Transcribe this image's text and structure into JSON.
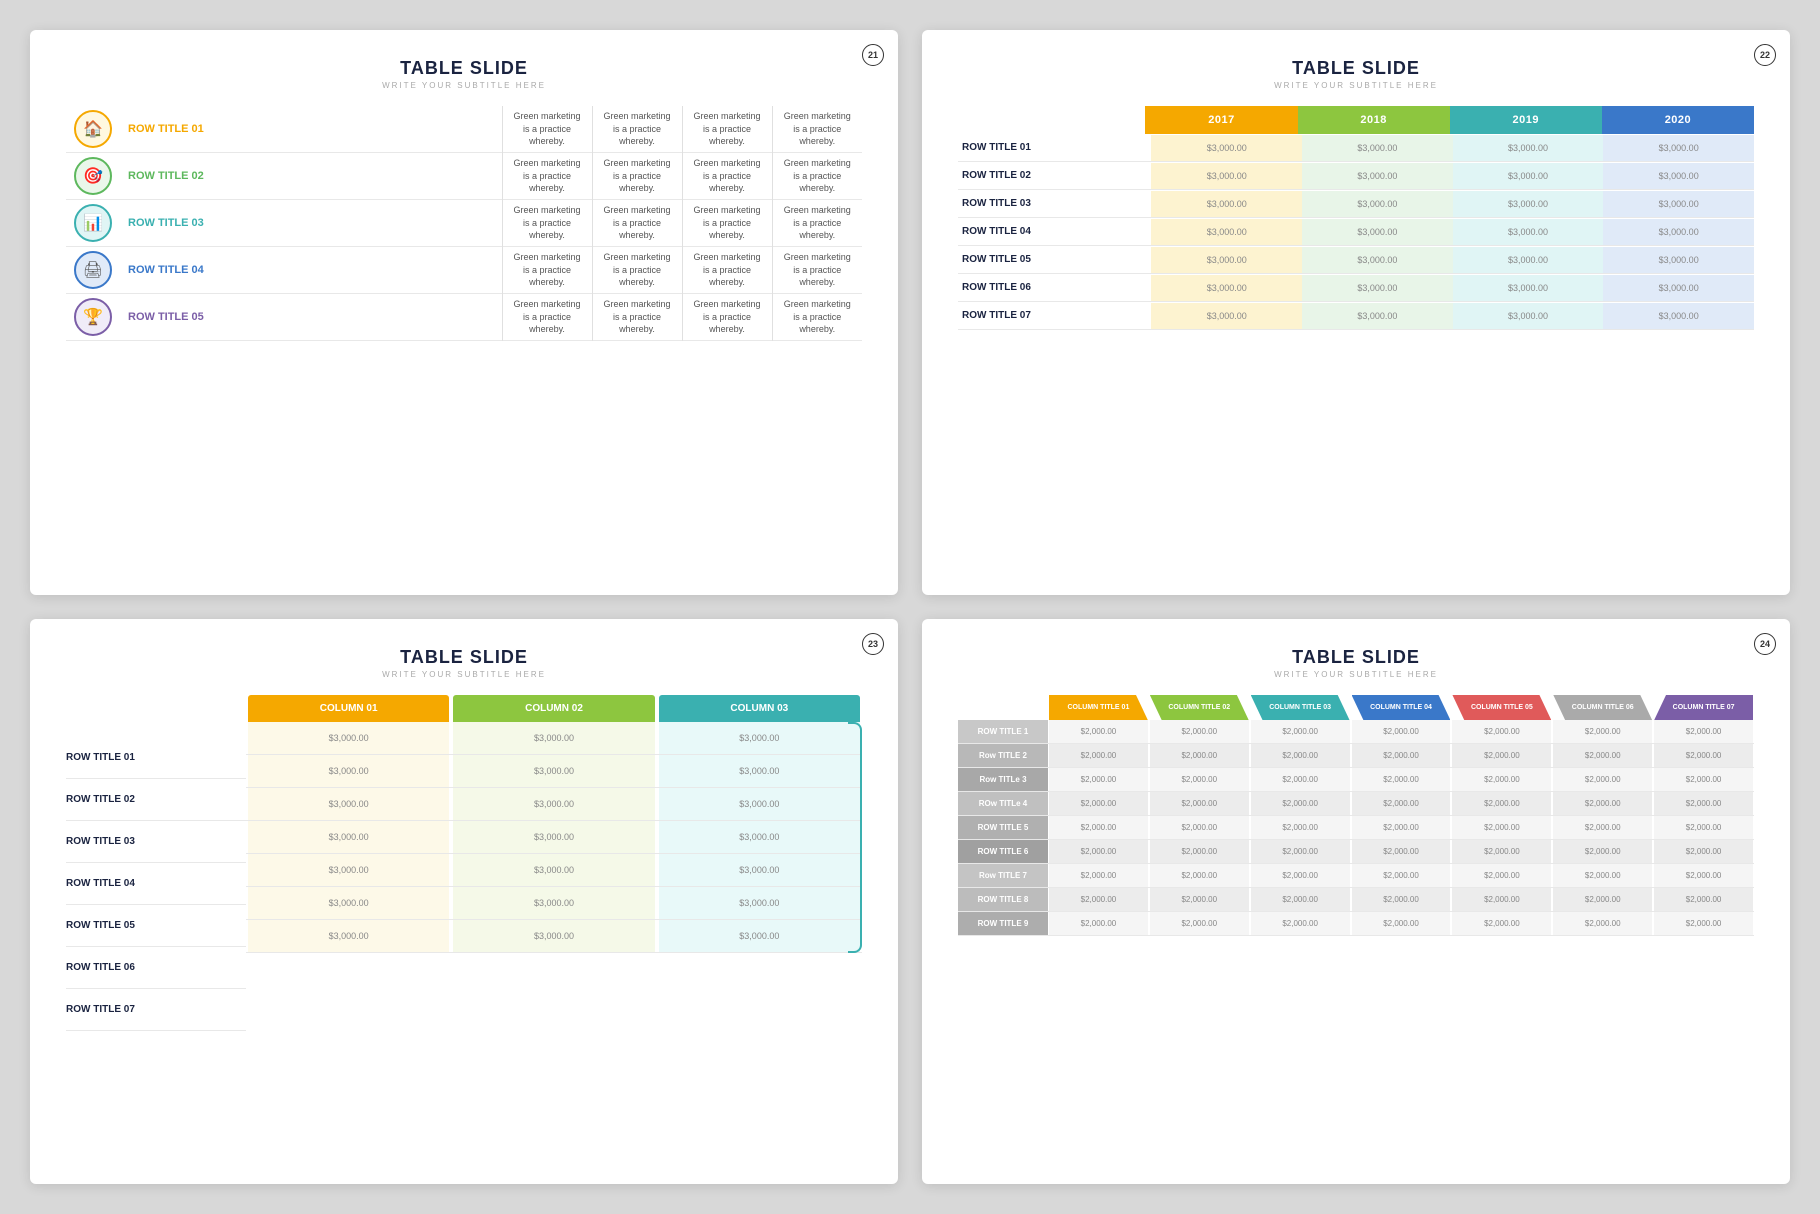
{
  "slide1": {
    "title": "TABLE SLIDE",
    "subtitle": "WRITE YOUR SUBTITLE HERE",
    "number": "21",
    "rows": [
      {
        "id": "01",
        "label": "ROW TITLE 01",
        "color": "yellow",
        "iconColor": "#f5a800",
        "iconBg": "#fff8e0",
        "desc": "Green marketing is a practice whereby."
      },
      {
        "id": "02",
        "label": "ROW TITLE 02",
        "color": "green",
        "iconColor": "#5db85d",
        "iconBg": "#eaf7ea",
        "desc": "Green marketing is a practice whereby."
      },
      {
        "id": "03",
        "label": "ROW TITLE 03",
        "color": "teal",
        "iconColor": "#3ab0b0",
        "iconBg": "#e0f5f5",
        "desc": "Green marketing is a practice whereby."
      },
      {
        "id": "04",
        "label": "ROW TITLE 04",
        "color": "blue",
        "iconColor": "#3a78c9",
        "iconBg": "#e0eaf8",
        "desc": "Green marketing is a practice whereby."
      },
      {
        "id": "05",
        "label": "ROW TITLE 05",
        "color": "purple",
        "iconColor": "#7b5ea7",
        "iconBg": "#f0ecf8",
        "desc": "Green marketing is a practice whereby."
      }
    ],
    "col_desc": "Green marketing is a practice whereby."
  },
  "slide2": {
    "title": "TABLE SLIDE",
    "subtitle": "WRITE YOUR SUBTITLE HERE",
    "number": "22",
    "headers": [
      "2017",
      "2018",
      "2019",
      "2020"
    ],
    "header_colors": [
      "#f5a800",
      "#8dc63f",
      "#3ab0b0",
      "#3a78c9"
    ],
    "rows": [
      {
        "label": "ROW TITLE 01",
        "values": [
          "$3,000.00",
          "$3,000.00",
          "$3,000.00",
          "$3,000.00"
        ]
      },
      {
        "label": "ROW TITLE 02",
        "values": [
          "$3,000.00",
          "$3,000.00",
          "$3,000.00",
          "$3,000.00"
        ]
      },
      {
        "label": "ROW TITLE 03",
        "values": [
          "$3,000.00",
          "$3,000.00",
          "$3,000.00",
          "$3,000.00"
        ]
      },
      {
        "label": "ROW TITLE 04",
        "values": [
          "$3,000.00",
          "$3,000.00",
          "$3,000.00",
          "$3,000.00"
        ]
      },
      {
        "label": "ROW TITLE 05",
        "values": [
          "$3,000.00",
          "$3,000.00",
          "$3,000.00",
          "$3,000.00"
        ]
      },
      {
        "label": "ROW TITLE 06",
        "values": [
          "$3,000.00",
          "$3,000.00",
          "$3,000.00",
          "$3,000.00"
        ]
      },
      {
        "label": "ROW TITLE 07",
        "values": [
          "$3,000.00",
          "$3,000.00",
          "$3,000.00",
          "$3,000.00"
        ]
      }
    ]
  },
  "slide3": {
    "title": "TABLE SLIDE",
    "subtitle": "WRITE YOUR SUBTITLE HERE",
    "number": "23",
    "headers": [
      "COLUMN 01",
      "COLUMN 02",
      "COLUMN 03"
    ],
    "header_colors": [
      "#f5a800",
      "#8dc63f",
      "#3ab0b0"
    ],
    "rows": [
      {
        "label": "ROW TITLE 01",
        "values": [
          "$3,000.00",
          "$3,000.00",
          "$3,000.00"
        ]
      },
      {
        "label": "ROW TITLE 02",
        "values": [
          "$3,000.00",
          "$3,000.00",
          "$3,000.00"
        ]
      },
      {
        "label": "ROW TITLE 03",
        "values": [
          "$3,000.00",
          "$3,000.00",
          "$3,000.00"
        ]
      },
      {
        "label": "ROW TITLE 04",
        "values": [
          "$3,000.00",
          "$3,000.00",
          "$3,000.00"
        ]
      },
      {
        "label": "ROW TITLE 05",
        "values": [
          "$3,000.00",
          "$3,000.00",
          "$3,000.00"
        ]
      },
      {
        "label": "ROW TITLE 06",
        "values": [
          "$3,000.00",
          "$3,000.00",
          "$3,000.00"
        ]
      },
      {
        "label": "ROW TITLE 07",
        "values": [
          "$3,000.00",
          "$3,000.00",
          "$3,000.00"
        ]
      }
    ]
  },
  "slide4": {
    "title": "TABLE SLIDE",
    "subtitle": "WRITE YOUR SUBTITLE HERE",
    "number": "24",
    "headers": [
      "COLUMN TITLE 01",
      "COLUMN TITLE 02",
      "COLUMN TITLE 03",
      "COLUMN TITLE 04",
      "COLUMN TITLE 05",
      "COLUMN TITLE 06",
      "COLUMN TITLE 07"
    ],
    "header_colors": [
      "#f5a800",
      "#8dc63f",
      "#3ab0b0",
      "#3a78c9",
      "#e05a5a",
      "#aaaaaa",
      "#7b5ea7"
    ],
    "rows": [
      {
        "label": "ROW TITLE 1",
        "values": [
          "$2,000.00",
          "$2,000.00",
          "$2,000.00",
          "$2,000.00",
          "$2,000.00",
          "$2,000.00",
          "$2,000.00"
        ]
      },
      {
        "label": "Row TITLE 2",
        "values": [
          "$2,000.00",
          "$2,000.00",
          "$2,000.00",
          "$2,000.00",
          "$2,000.00",
          "$2,000.00",
          "$2,000.00"
        ]
      },
      {
        "label": "Row TITLe 3",
        "values": [
          "$2,000.00",
          "$2,000.00",
          "$2,000.00",
          "$2,000.00",
          "$2,000.00",
          "$2,000.00",
          "$2,000.00"
        ]
      },
      {
        "label": "ROw TITLe 4",
        "values": [
          "$2,000.00",
          "$2,000.00",
          "$2,000.00",
          "$2,000.00",
          "$2,000.00",
          "$2,000.00",
          "$2,000.00"
        ]
      },
      {
        "label": "ROW TITLE 5",
        "values": [
          "$2,000.00",
          "$2,000.00",
          "$2,000.00",
          "$2,000.00",
          "$2,000.00",
          "$2,000.00",
          "$2,000.00"
        ]
      },
      {
        "label": "ROW TITLE 6",
        "values": [
          "$2,000.00",
          "$2,000.00",
          "$2,000.00",
          "$2,000.00",
          "$2,000.00",
          "$2,000.00",
          "$2,000.00"
        ]
      },
      {
        "label": "Row TITLE 7",
        "values": [
          "$2,000.00",
          "$2,000.00",
          "$2,000.00",
          "$2,000.00",
          "$2,000.00",
          "$2,000.00",
          "$2,000.00"
        ]
      },
      {
        "label": "ROW TITLE 8",
        "values": [
          "$2,000.00",
          "$2,000.00",
          "$2,000.00",
          "$2,000.00",
          "$2,000.00",
          "$2,000.00",
          "$2,000.00"
        ]
      },
      {
        "label": "ROW TITLE 9",
        "values": [
          "$2,000.00",
          "$2,000.00",
          "$2,000.00",
          "$2,000.00",
          "$2,000.00",
          "$2,000.00",
          "$2,000.00"
        ]
      }
    ]
  }
}
